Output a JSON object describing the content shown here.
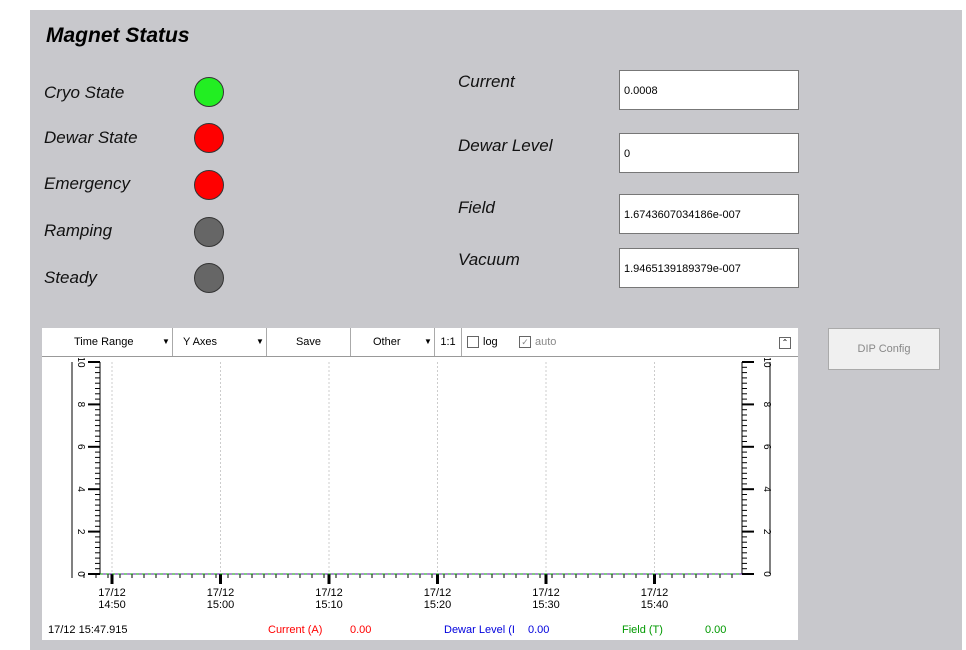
{
  "header": {
    "title": "Magnet Status"
  },
  "indicators": [
    {
      "label": "Cryo State",
      "color": "#22ee22"
    },
    {
      "label": "Dewar State",
      "color": "#ff0000"
    },
    {
      "label": "Emergency",
      "color": "#ff0000"
    },
    {
      "label": "Ramping",
      "color": "#666666"
    },
    {
      "label": "Steady",
      "color": "#666666"
    }
  ],
  "readouts": [
    {
      "label": "Current",
      "value": "0.0008"
    },
    {
      "label": "Dewar Level",
      "value": "0"
    },
    {
      "label": "Field",
      "value": "1.6743607034186e-007"
    },
    {
      "label": "Vacuum",
      "value": "1.9465139189379e-007"
    }
  ],
  "toolbar": {
    "time_range": "Time Range",
    "y_axes": "Y Axes",
    "save": "Save",
    "other": "Other",
    "ratio": "1:1",
    "log": "log",
    "auto": "auto",
    "collapse_icon": "double-chevron-up-icon"
  },
  "dip_button": "DIP Config",
  "status_bar": {
    "timestamp": "17/12 15:47.915",
    "current_label": "Current (A)",
    "current_value": "0.00",
    "current_color": "#ff0000",
    "dewar_label": "Dewar Level (I",
    "dewar_value": "0.00",
    "dewar_color": "#0000dd",
    "field_label": "Field (T)",
    "field_value": "0.00",
    "field_color": "#009900"
  },
  "chart_data": {
    "type": "line",
    "y_ticks": [
      "0",
      "2",
      "4",
      "6",
      "8",
      "10"
    ],
    "ylim": [
      0,
      10
    ],
    "x_ticks": [
      {
        "date": "17/12",
        "time": "14:50"
      },
      {
        "date": "17/12",
        "time": "15:00"
      },
      {
        "date": "17/12",
        "time": "15:10"
      },
      {
        "date": "17/12",
        "time": "15:20"
      },
      {
        "date": "17/12",
        "time": "15:30"
      },
      {
        "date": "17/12",
        "time": "15:40"
      }
    ],
    "series": [
      {
        "name": "Current (A)",
        "values": [
          0,
          0,
          0,
          0,
          0,
          0
        ]
      },
      {
        "name": "Dewar Level (I",
        "values": [
          0,
          0,
          0,
          0,
          0,
          0
        ]
      },
      {
        "name": "Field (T)",
        "values": [
          0,
          0,
          0,
          0,
          0,
          0
        ]
      }
    ]
  }
}
